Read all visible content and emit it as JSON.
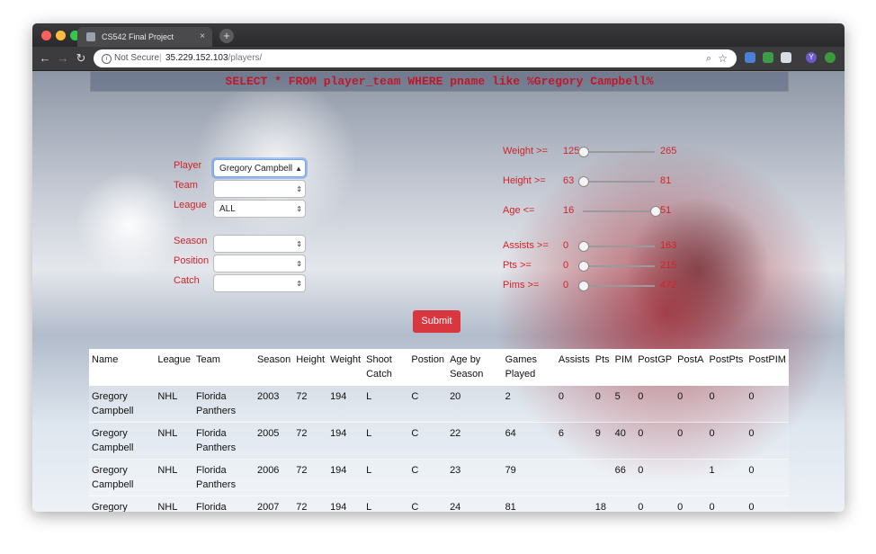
{
  "browser": {
    "tab_title": "CS542 Final Project",
    "tab_close": "×",
    "new_tab": "+",
    "not_secure": "Not Secure",
    "url_host": "35.229.152.103",
    "url_path": "/players/",
    "ext_badge": "Y"
  },
  "query": "SELECT * FROM player_team WHERE pname like %Gregory Campbell%",
  "filters": {
    "player_label": "Player",
    "player_value": "Gregory Campbell",
    "team_label": "Team",
    "team_value": "",
    "league_label": "League",
    "league_value": "ALL",
    "season_label": "Season",
    "season_value": "",
    "position_label": "Position",
    "position_value": "",
    "catch_label": "Catch",
    "catch_value": ""
  },
  "ranges": [
    {
      "label": "Weight >=",
      "min": "125",
      "max": "265",
      "level": 0.0
    },
    {
      "label": "Height >=",
      "min": "63",
      "max": "81",
      "level": 0.0
    },
    {
      "label": "Age <=",
      "min": "16",
      "max": "51",
      "level": 1.0
    },
    {
      "label": "Assists >=",
      "min": "0",
      "max": "163",
      "level": 0.0
    },
    {
      "label": "Pts >=",
      "min": "0",
      "max": "215",
      "level": 0.0
    },
    {
      "label": "Pims >=",
      "min": "0",
      "max": "472",
      "level": 0.0
    }
  ],
  "submit_label": "Submit",
  "table": {
    "headers": [
      "Name",
      "League",
      "Team",
      "Season",
      "Height",
      "Weight",
      "Shoot Catch",
      "Postion",
      "Age by Season",
      "Games Played",
      "Assists",
      "Pts",
      "PIM",
      "PostGP",
      "PostA",
      "PostPts",
      "PostPIM"
    ],
    "rows": [
      [
        "Gregory Campbell",
        "NHL",
        "Florida Panthers",
        "2003",
        "72",
        "194",
        "L",
        "C",
        "20",
        "2",
        "0",
        "0",
        "5",
        "0",
        "0",
        "0",
        "0"
      ],
      [
        "Gregory Campbell",
        "NHL",
        "Florida Panthers",
        "2005",
        "72",
        "194",
        "L",
        "C",
        "22",
        "64",
        "6",
        "9",
        "40",
        "0",
        "0",
        "0",
        "0"
      ],
      [
        "Gregory Campbell",
        "NHL",
        "Florida Panthers",
        "2006",
        "72",
        "194",
        "L",
        "C",
        "23",
        "79",
        "",
        "",
        "66",
        "0",
        "",
        "1",
        "0"
      ],
      [
        "Gregory Campbell",
        "NHL",
        "Florida Panthers",
        "2007",
        "72",
        "194",
        "L",
        "C",
        "24",
        "81",
        "",
        "18",
        "",
        "0",
        "0",
        "0",
        "0"
      ]
    ]
  },
  "colors": {
    "accent_red": "#d2232a",
    "submit_red": "#d8373f"
  }
}
